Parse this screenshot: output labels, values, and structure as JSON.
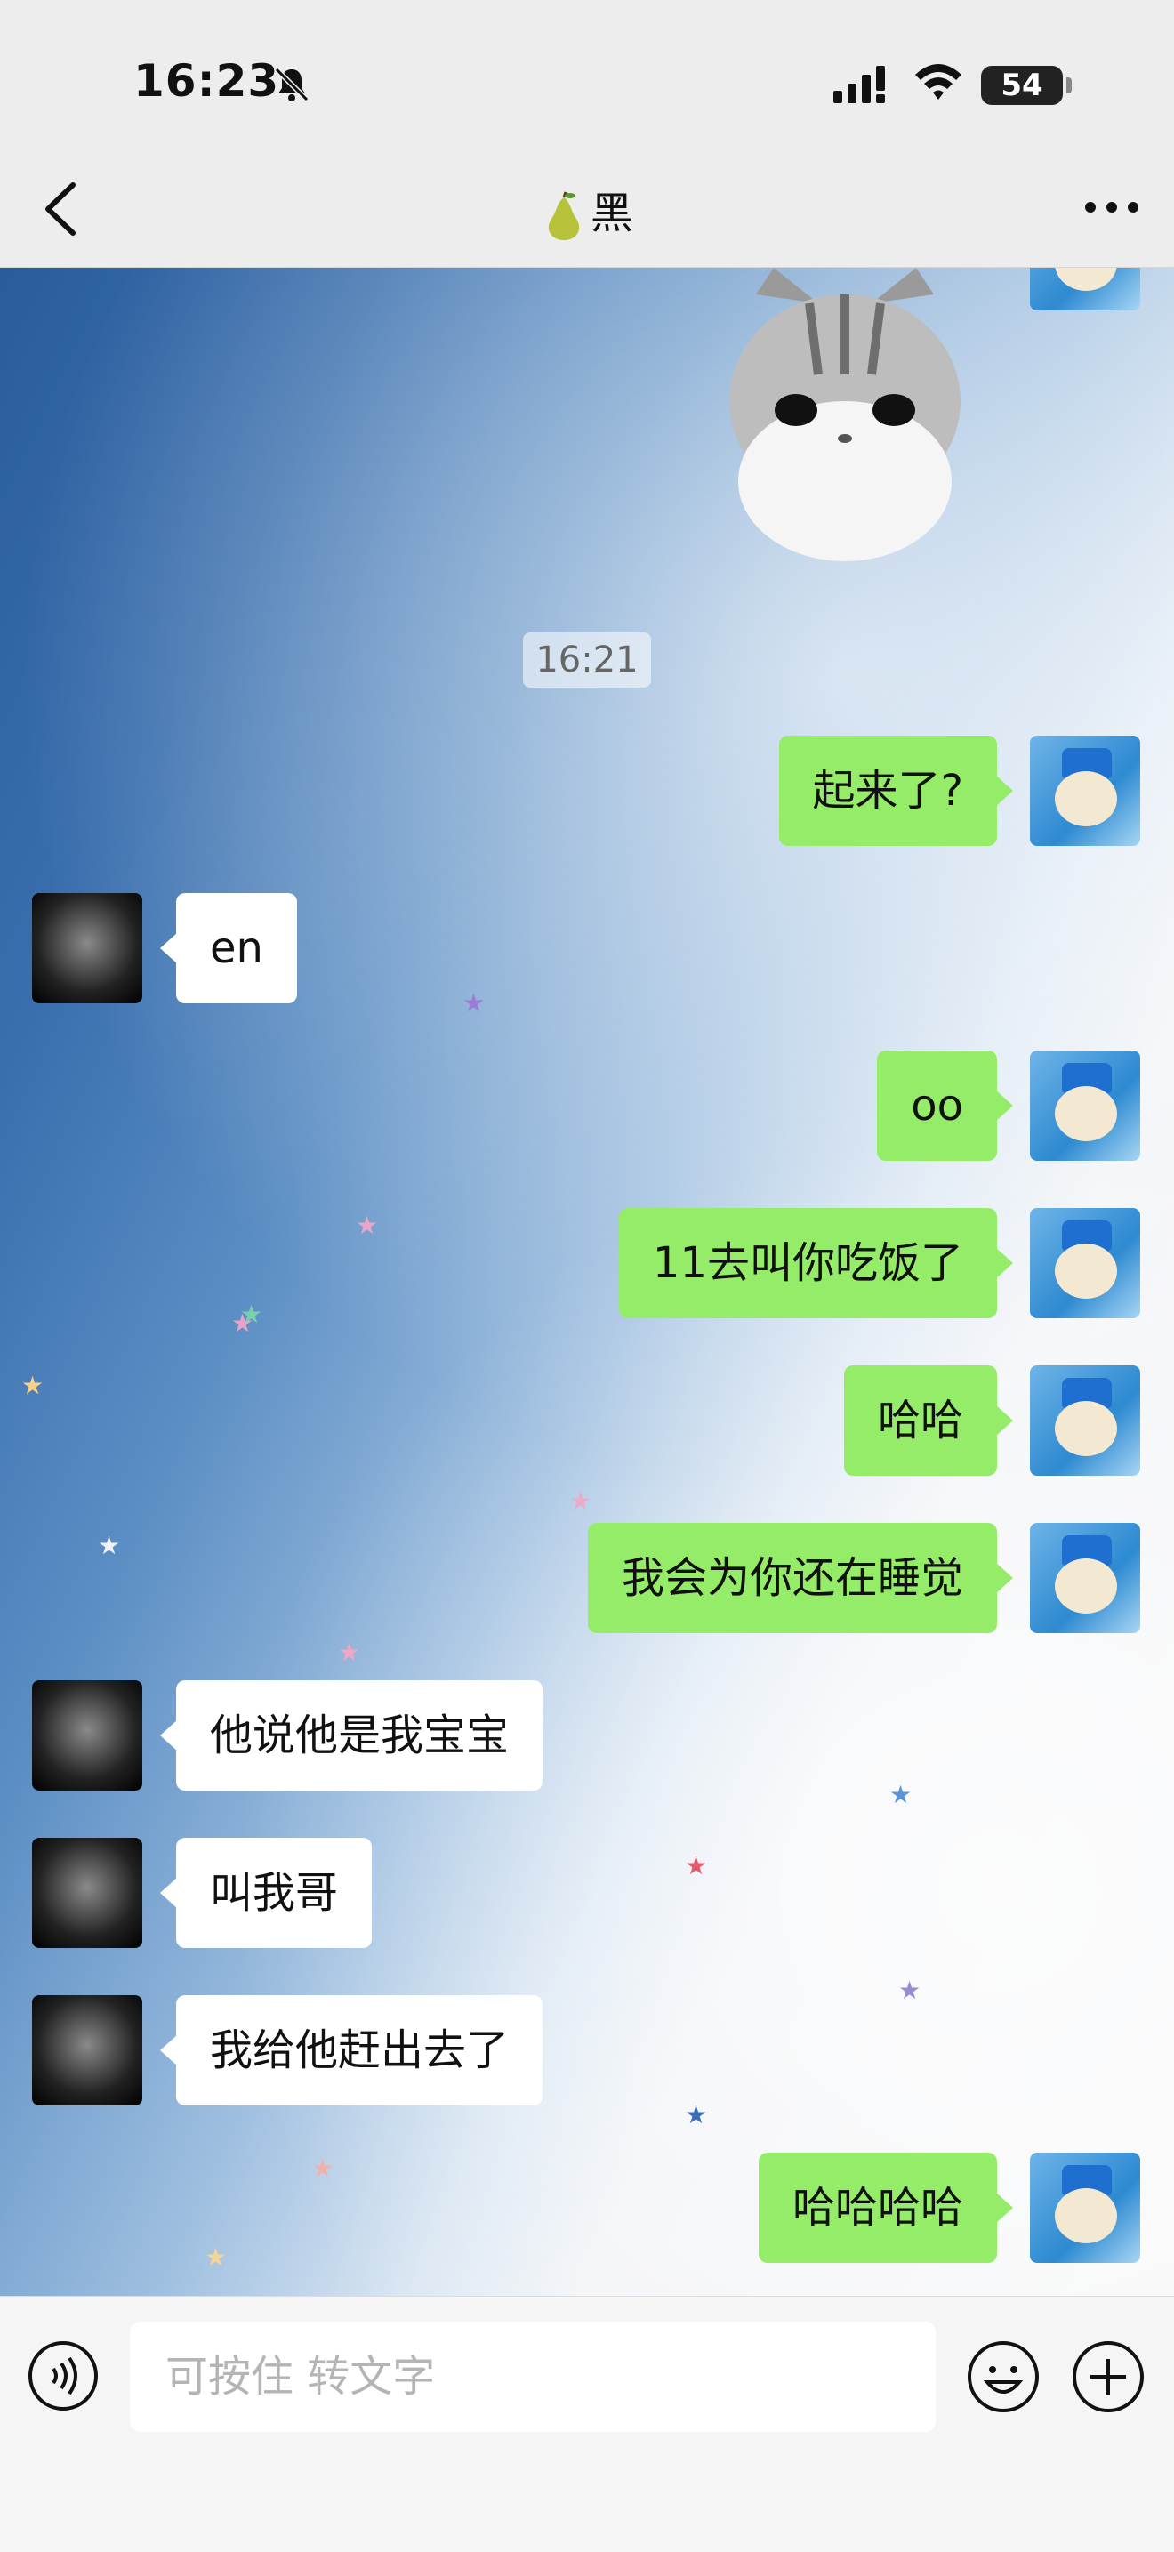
{
  "status_bar": {
    "time": "16:23",
    "battery": "54"
  },
  "header": {
    "title": "黑"
  },
  "timestamp": "16:21",
  "messages": [
    {
      "side": "me",
      "text": "起来了?"
    },
    {
      "side": "them",
      "text": "en"
    },
    {
      "side": "me",
      "text": "oo"
    },
    {
      "side": "me",
      "text": "11去叫你吃饭了"
    },
    {
      "side": "me",
      "text": "哈哈"
    },
    {
      "side": "me",
      "text": "我会为你还在睡觉"
    },
    {
      "side": "them",
      "text": "他说他是我宝宝"
    },
    {
      "side": "them",
      "text": "叫我哥"
    },
    {
      "side": "them",
      "text": "我给他赶出去了"
    },
    {
      "side": "me",
      "text": "哈哈哈哈"
    }
  ],
  "input": {
    "placeholder": "可按住 转文字"
  },
  "colors": {
    "my_bubble": "#95ec69",
    "their_bubble": "#ffffff",
    "chrome": "#ededed"
  }
}
